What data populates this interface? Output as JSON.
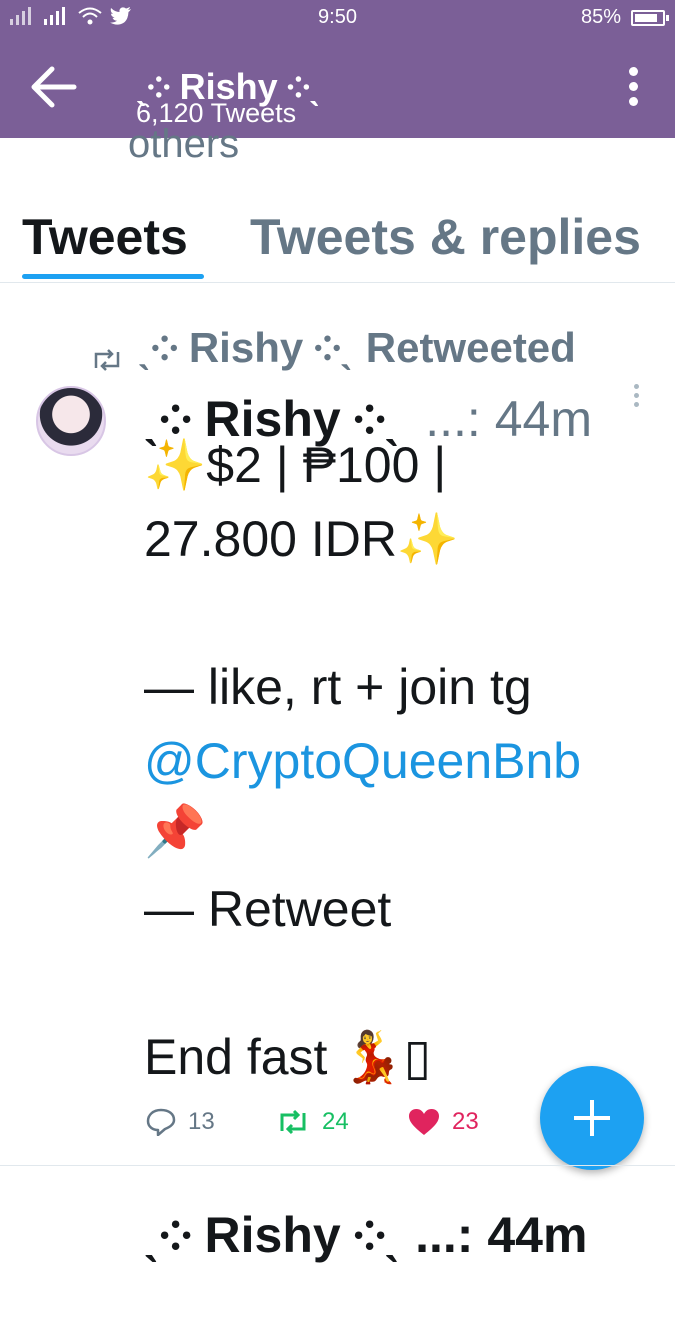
{
  "status_bar": {
    "time": "9:50",
    "battery": "85%",
    "battery_level": 0.85,
    "icons": [
      "signal-icon",
      "signal-icon",
      "wifi-icon",
      "twitter-bird-icon",
      "battery-icon"
    ]
  },
  "header": {
    "title": "ˎ༶ Rishy ༶ˎ",
    "subtitle": "6,120 Tweets",
    "colors": {
      "bar": "#7b5f97"
    }
  },
  "remnant_text": "others",
  "tabs": [
    {
      "label": "Tweets",
      "active": true
    },
    {
      "label": "Tweets & replies",
      "active": false
    }
  ],
  "tweet": {
    "retweet_context": "ˎ༶ Rishy ༶ˎ Retweeted",
    "author_name": "ˎ༶ Rishy ༶ˎ",
    "meta": "...: 44m",
    "lines": {
      "l1": "✨$2 | ₱100 |",
      "l2": "27.800 IDR✨",
      "l3": "— like, rt + join tg",
      "mention": "@CryptoQueenBnb",
      "pin": "📌",
      "l4": "— Retweet",
      "l5": "End fast 💃▯"
    },
    "reply_count": "13",
    "retweet_count": "24",
    "like_count": "23"
  },
  "next_peek": "ˎ༶ Rishy ༶ˎ ...: 44m",
  "accent": "#1da1f2"
}
